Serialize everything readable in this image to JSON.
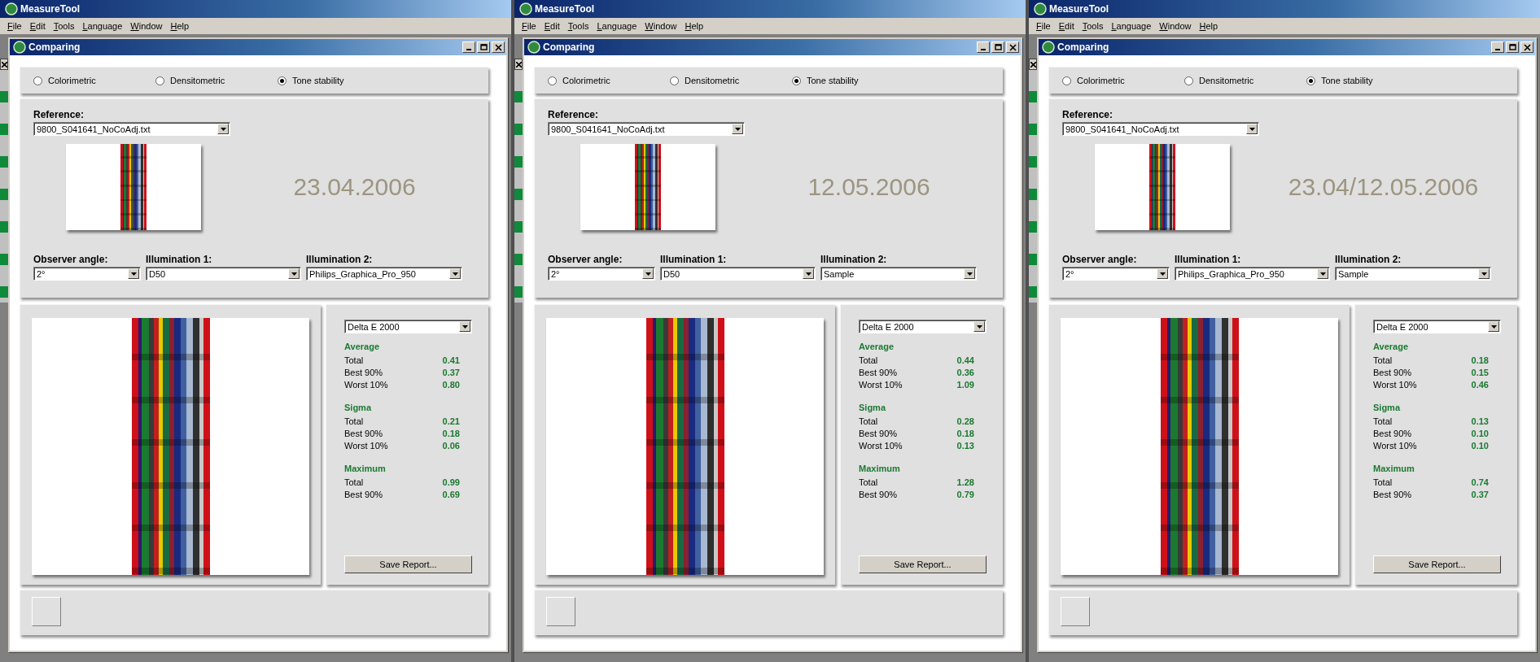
{
  "panes": [
    {
      "app_title": "MeasureTool",
      "menu": [
        "File",
        "Edit",
        "Tools",
        "Language",
        "Window",
        "Help"
      ],
      "child_title": "Comparing",
      "modes": [
        {
          "label": "Colorimetric",
          "selected": false
        },
        {
          "label": "Densitometric",
          "selected": false
        },
        {
          "label": "Tone stability",
          "selected": true
        }
      ],
      "reference": {
        "label": "Reference:",
        "value": "9800_S041641_NoCoAdj.txt"
      },
      "date": "23.04.2006",
      "selectors": [
        {
          "label": "Observer angle:",
          "value": "2°"
        },
        {
          "label": "Illumination 1:",
          "value": "D50"
        },
        {
          "label": "Illumination 2:",
          "value": "Philips_Graphica_Pro_950"
        }
      ],
      "metric": "Delta E 2000",
      "stats": [
        {
          "title": "Average",
          "rows": [
            {
              "label": "Total",
              "value": "0.41"
            },
            {
              "label": "Best 90%",
              "value": "0.37"
            },
            {
              "label": "Worst 10%",
              "value": "0.80"
            }
          ]
        },
        {
          "title": "Sigma",
          "rows": [
            {
              "label": "Total",
              "value": "0.21"
            },
            {
              "label": "Best 90%",
              "value": "0.18"
            },
            {
              "label": "Worst 10%",
              "value": "0.06"
            }
          ]
        },
        {
          "title": "Maximum",
          "rows": [
            {
              "label": "Total",
              "value": "0.99"
            },
            {
              "label": "Best 90%",
              "value": "0.69"
            }
          ]
        }
      ],
      "save_button": "Save Report..."
    },
    {
      "app_title": "MeasureTool",
      "menu": [
        "File",
        "Edit",
        "Tools",
        "Language",
        "Window",
        "Help"
      ],
      "child_title": "Comparing",
      "modes": [
        {
          "label": "Colorimetric",
          "selected": false
        },
        {
          "label": "Densitometric",
          "selected": false
        },
        {
          "label": "Tone stability",
          "selected": true
        }
      ],
      "reference": {
        "label": "Reference:",
        "value": "9800_S041641_NoCoAdj.txt"
      },
      "date": "12.05.2006",
      "selectors": [
        {
          "label": "Observer angle:",
          "value": "2°"
        },
        {
          "label": "Illumination 1:",
          "value": "D50"
        },
        {
          "label": "Illumination 2:",
          "value": "Sample"
        }
      ],
      "metric": "Delta E 2000",
      "stats": [
        {
          "title": "Average",
          "rows": [
            {
              "label": "Total",
              "value": "0.44"
            },
            {
              "label": "Best 90%",
              "value": "0.36"
            },
            {
              "label": "Worst 10%",
              "value": "1.09"
            }
          ]
        },
        {
          "title": "Sigma",
          "rows": [
            {
              "label": "Total",
              "value": "0.28"
            },
            {
              "label": "Best 90%",
              "value": "0.18"
            },
            {
              "label": "Worst 10%",
              "value": "0.13"
            }
          ]
        },
        {
          "title": "Maximum",
          "rows": [
            {
              "label": "Total",
              "value": "1.28"
            },
            {
              "label": "Best 90%",
              "value": "0.79"
            }
          ]
        }
      ],
      "save_button": "Save Report..."
    },
    {
      "app_title": "MeasureTool",
      "menu": [
        "File",
        "Edit",
        "Tools",
        "Language",
        "Window",
        "Help"
      ],
      "child_title": "Comparing",
      "modes": [
        {
          "label": "Colorimetric",
          "selected": false
        },
        {
          "label": "Densitometric",
          "selected": false
        },
        {
          "label": "Tone stability",
          "selected": true
        }
      ],
      "reference": {
        "label": "Reference:",
        "value": "9800_S041641_NoCoAdj.txt"
      },
      "date": "23.04/12.05.2006",
      "selectors": [
        {
          "label": "Observer angle:",
          "value": "2°"
        },
        {
          "label": "Illumination 1:",
          "value": "Philips_Graphica_Pro_950"
        },
        {
          "label": "Illumination 2:",
          "value": "Sample"
        }
      ],
      "metric": "Delta E 2000",
      "stats": [
        {
          "title": "Average",
          "rows": [
            {
              "label": "Total",
              "value": "0.18"
            },
            {
              "label": "Best 90%",
              "value": "0.15"
            },
            {
              "label": "Worst 10%",
              "value": "0.46"
            }
          ]
        },
        {
          "title": "Sigma",
          "rows": [
            {
              "label": "Total",
              "value": "0.13"
            },
            {
              "label": "Best 90%",
              "value": "0.10"
            },
            {
              "label": "Worst 10%",
              "value": "0.10"
            }
          ]
        },
        {
          "title": "Maximum",
          "rows": [
            {
              "label": "Total",
              "value": "0.74"
            },
            {
              "label": "Best 90%",
              "value": "0.37"
            }
          ]
        }
      ],
      "save_button": "Save Report..."
    }
  ]
}
